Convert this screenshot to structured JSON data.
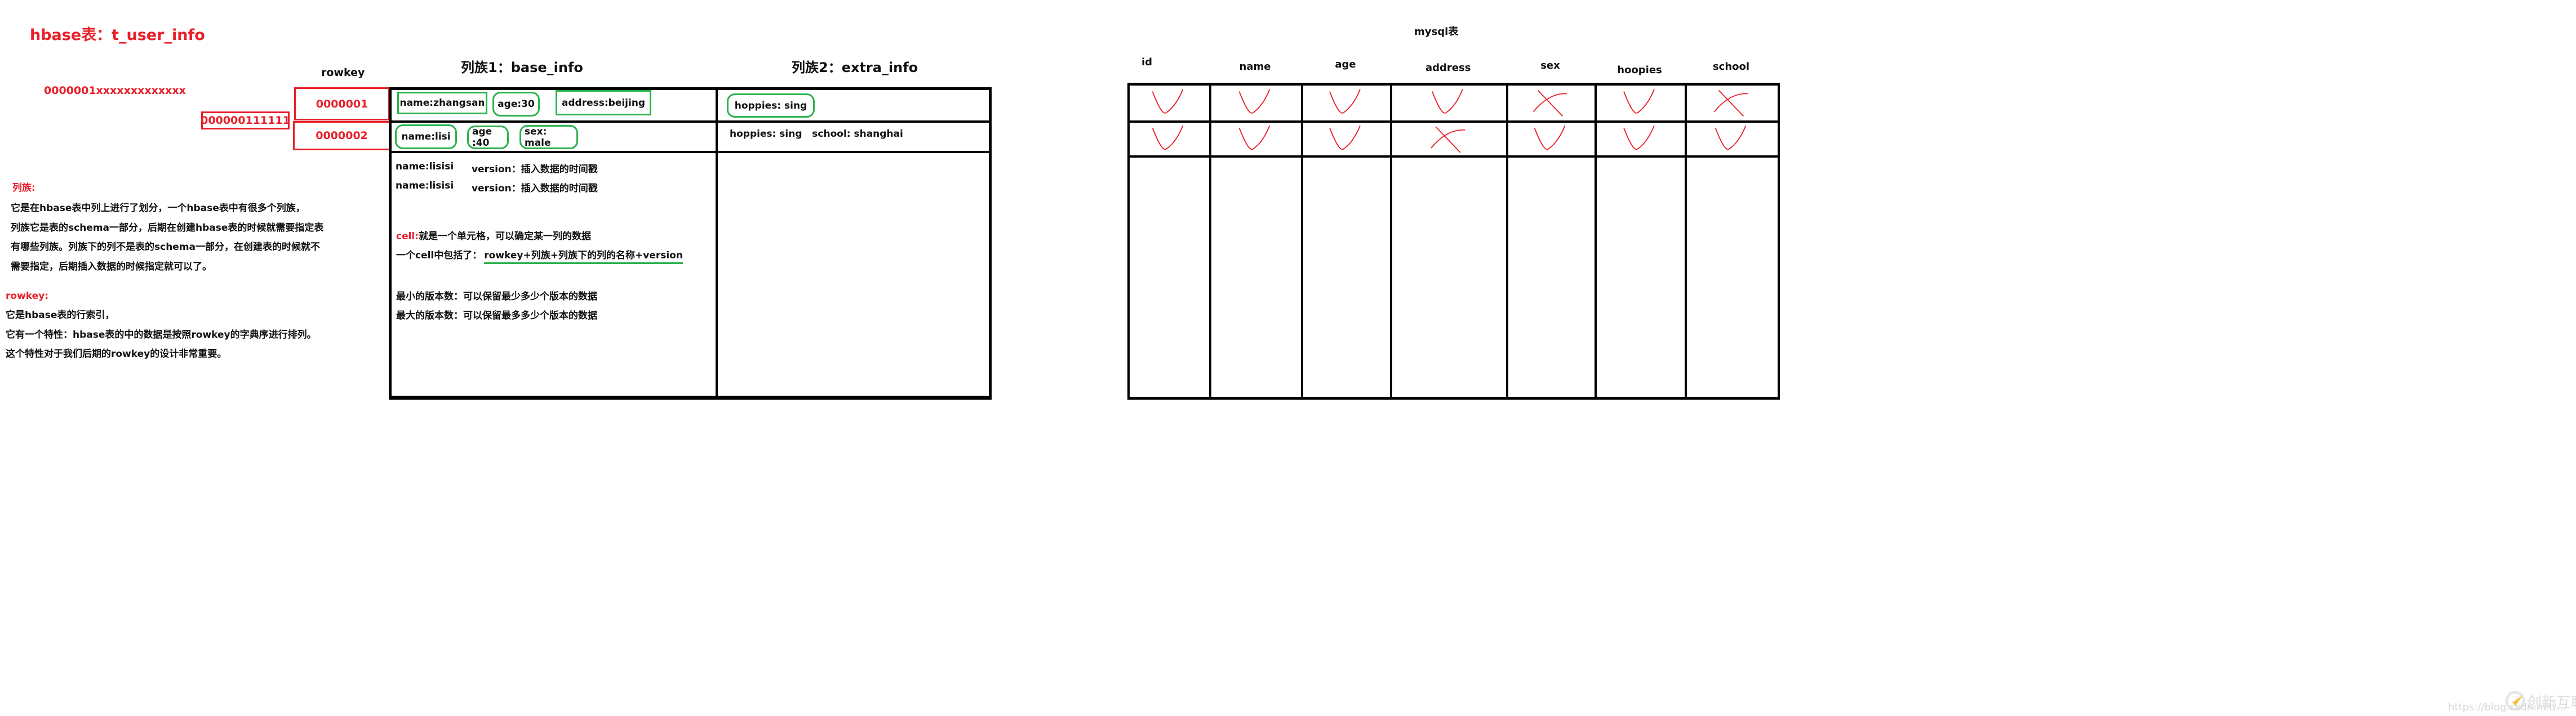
{
  "title": "hbase表：t_user_info",
  "loose_rowkey_text": "0000001xxxxxxxxxxxxx",
  "lexical_example_box": "000000111111",
  "rowkey_label": "rowkey",
  "rowkeys": [
    "0000001",
    "0000002"
  ],
  "notes": {
    "column_family": {
      "heading": "列族:",
      "lines": [
        "它是在hbase表中列上进行了划分，一个hbase表中有很多个列族，",
        "列族它是表的schema一部分，后期在创建hbase表的时候就需要指定表",
        "有哪些列族。列族下的列不是表的schema一部分，在创建表的时候就不",
        "需要指定，后期插入数据的时候指定就可以了。"
      ]
    },
    "rowkey": {
      "heading": "rowkey:",
      "lines": [
        "它是hbase表的行索引，",
        "它有一个特性：hbase表的中的数据是按照rowkey的字典序进行排列。",
        "这个特性对于我们后期的rowkey的设计非常重要。"
      ]
    }
  },
  "hbase_table": {
    "families": [
      {
        "header": "列族1：base_info"
      },
      {
        "header": "列族2：extra_info"
      }
    ],
    "row1": {
      "base_info": [
        "name:zhangsan",
        "age:30",
        "address:beijing"
      ],
      "extra_info": [
        "hoppies: sing"
      ]
    },
    "row2": {
      "base_info": [
        "name:lisi",
        "age :40",
        "sex: male"
      ],
      "extra_info": "hoppies: sing   school: shanghai"
    },
    "explanations": {
      "version_lines": [
        {
          "name": "name:lisisi",
          "version": "version：插入数据的时间戳"
        },
        {
          "name": "name:lisisi",
          "version": "version：插入数据的时间戳"
        }
      ],
      "cell_keyword": "cell:",
      "cell_def": "就是一个单元格，可以确定某一列的数据",
      "cell_contains_prefix": "一个cell中包括了：",
      "cell_contains_value": "rowkey+列族+列族下的列的名称+version",
      "min_versions": "最小的版本数：可以保留最少多少个版本的数据",
      "max_versions": "最大的版本数：可以保留最多多少个版本的数据"
    }
  },
  "mysql_table": {
    "title": "mysql表",
    "columns": [
      "id",
      "name",
      "age",
      "address",
      "sex",
      "hoopies",
      "school"
    ],
    "rows": [
      [
        "check",
        "check",
        "check",
        "check",
        "cross",
        "check",
        "cross"
      ],
      [
        "check",
        "check",
        "check",
        "cross",
        "check",
        "check",
        "check"
      ]
    ]
  },
  "watermark": {
    "brand": "创新互联",
    "url": "https://blog.csdn.net/..."
  },
  "colors": {
    "red": "#e8202a",
    "green": "#2bb24c",
    "black": "#000000"
  }
}
